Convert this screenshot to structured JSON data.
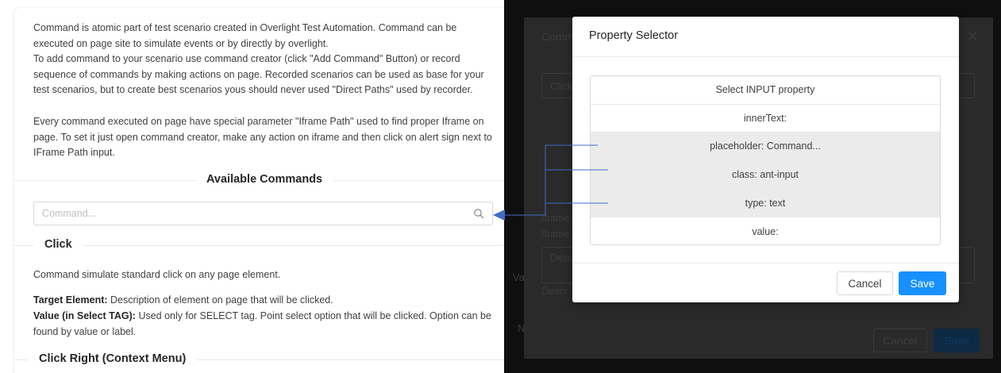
{
  "help": {
    "intro": [
      "Command is atomic part of test scenario created in Overlight Test Automation. Command can be executed on page site to simulate events or by directly by overlight.",
      "To add command to your scenario use command creator (click \"Add Command\" Button) or record sequence of commands by making actions on page. Recorded scenarios can be used as base for your test scenarios, but to create best scenarios yous should never used \"Direct Paths\" used by recorder.",
      "Every command executed on page have special parameter \"Iframe Path\" used to find proper Iframe on page. To set it just open command creator, make any action on iframe and then click on alert sign next to IFrame Path input."
    ],
    "available_commands_title": "Available Commands",
    "search_placeholder": "Command...",
    "click": {
      "title": "Click",
      "description": "Command simulate standard click on any page element.",
      "target_label": "Target Element:",
      "target_text": " Description of element on page that will be clicked.",
      "value_label": "Value (in Select TAG):",
      "value_text": " Used only for SELECT tag. Point select option that will be clicked. Option can be found by value or label."
    },
    "click_right_title": "Click Right (Context Menu)"
  },
  "background_modal": {
    "title_partial": "Comm",
    "field_partial": "Click",
    "iframe_partial_1": "Iframe",
    "iframe_partial_2": "Iframe",
    "desc_partial": "Desc",
    "desc_partial_2": "Descr",
    "va_partial": "Va",
    "n_partial": "N",
    "cancel_label": "Cancel",
    "save_label": "Save"
  },
  "property_selector": {
    "title": "Property Selector",
    "header_row": "Select INPUT property",
    "rows": [
      {
        "label": "innerText:",
        "highlighted": false
      },
      {
        "label": "placeholder: Command...",
        "highlighted": true
      },
      {
        "label": "class: ant-input",
        "highlighted": true
      },
      {
        "label": "type: text",
        "highlighted": true
      },
      {
        "label": "value:",
        "highlighted": false
      }
    ],
    "cancel_label": "Cancel",
    "save_label": "Save"
  },
  "colors": {
    "primary": "#1890ff",
    "connector": "#3f6cc4",
    "dark_backdrop": "#0f0f0f"
  }
}
